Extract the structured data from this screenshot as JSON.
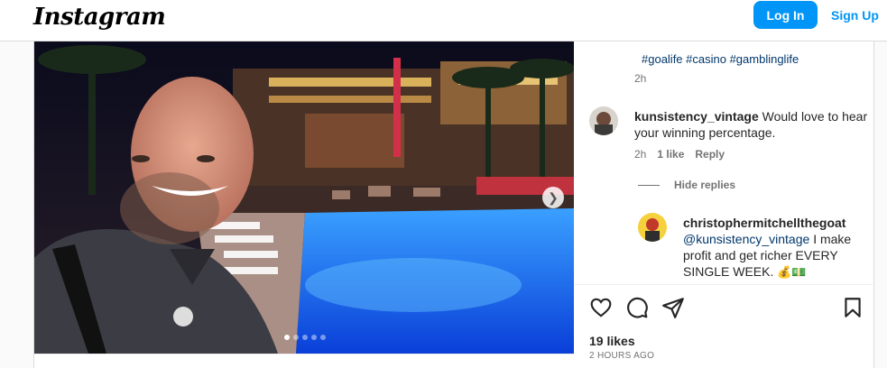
{
  "header": {
    "logo": "Instagram",
    "login_label": "Log In",
    "signup_label": "Sign Up"
  },
  "media": {
    "carousel_dots": 5,
    "active_dot": 1
  },
  "comments": {
    "partial_hashtags": "#goalife  #casino  #gamblinglife",
    "first_time": "2h",
    "items": [
      {
        "username": "kunsistency_vintage",
        "text": "Would love to hear your winning percentage.",
        "time": "2h",
        "likes": "1 like",
        "reply": "Reply"
      }
    ],
    "hide_replies": "Hide replies",
    "replies": [
      {
        "username": "christophermitchellthegoat",
        "mention": "@kunsistency_vintage",
        "text": "I make profit and get richer EVERY SINGLE WEEK.",
        "emoji": "💰💵"
      }
    ]
  },
  "footer": {
    "likes": "19 likes",
    "time_ago": "2 HOURS AGO"
  }
}
